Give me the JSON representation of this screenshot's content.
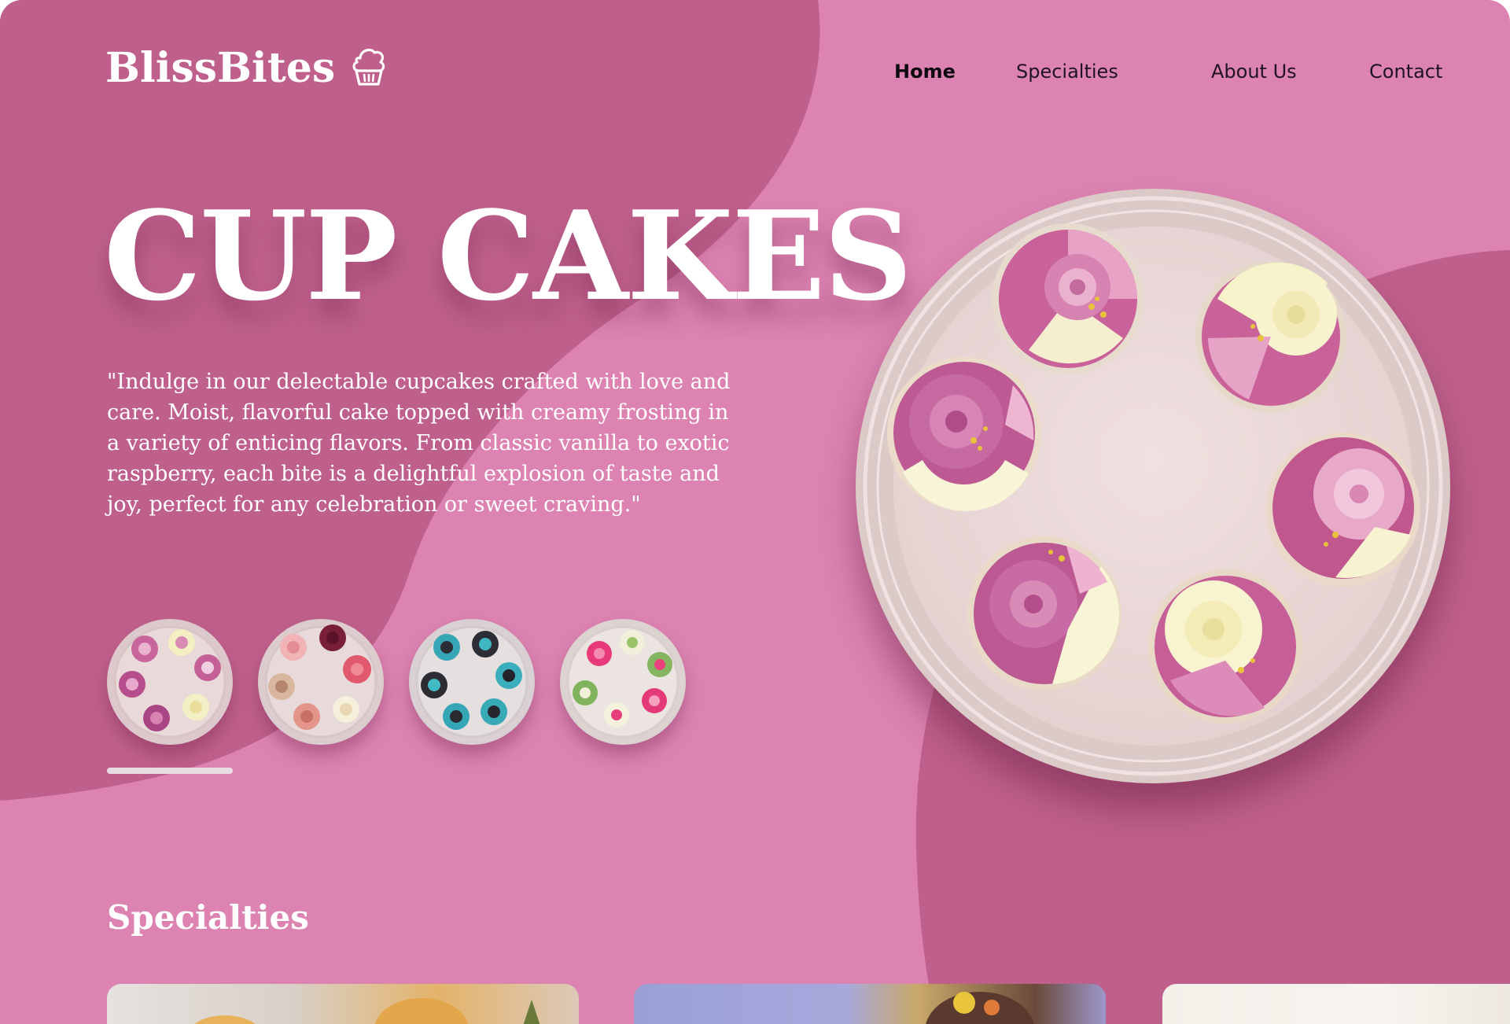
{
  "brand": {
    "name": "BlissBites",
    "logo_icon": "cupcake-icon"
  },
  "nav": {
    "items": [
      "Home",
      "Specialties",
      "About Us",
      "Contact"
    ],
    "active": "Home"
  },
  "hero": {
    "title": "CUP CAKES",
    "description": "\"Indulge in our delectable cupcakes crafted with love and care. Moist, flavorful cake topped with creamy frosting in a variety of enticing flavors. From classic vanilla to exotic raspberry, each bite is a delightful explosion of taste and joy, perfect for any celebration or sweet craving.\"",
    "featured_image": "plate of six pink, purple and cream rose cupcakes",
    "thumbnails": [
      "plate of pink and cream rose cupcakes",
      "plate of assorted cupcakes",
      "plate of teal and black cupcakes",
      "plate of green and pink flower cupcakes"
    ],
    "selected_thumbnail_index": 0
  },
  "specialties": {
    "heading": "Specialties",
    "cards": [
      "specialty photo 1",
      "specialty photo 2",
      "specialty photo 3"
    ]
  },
  "colors": {
    "background": "#dc83b2",
    "blob": "#bf608c",
    "text_light": "#ffffff",
    "nav_text": "#1f1420",
    "plate": "#e8d8d6"
  }
}
